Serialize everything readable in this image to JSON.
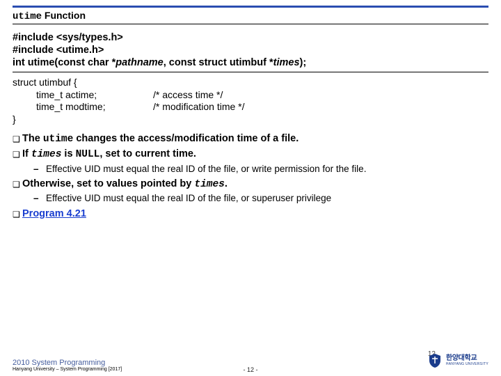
{
  "title": {
    "mono": "utime",
    "rest": " Function"
  },
  "signature": {
    "line1": "#include <sys/types.h>",
    "line2": "#include <utime.h>",
    "line3_a": "int utime(const char *",
    "line3_b": "pathname",
    "line3_c": ", const struct utimbuf *",
    "line3_d": "times",
    "line3_e": ");"
  },
  "struct": {
    "open": "struct utimbuf {",
    "r1_decl": "time_t  actime;",
    "r1_comment": "/* access time */",
    "r2_decl": "time_t  modtime;",
    "r2_comment": "/* modification time */",
    "close": "}"
  },
  "bullets": {
    "b1_a": "The ",
    "b1_mono": "utime",
    "b1_b": " changes the access/modification time of a file.",
    "b2_a": "If ",
    "b2_mono": "times",
    "b2_b": " is ",
    "b2_mono2": "NULL",
    "b2_c": ", set to current time.",
    "s1": "Effective UID must equal the real ID of the file, or write permission for the file.",
    "b3_a": "Otherwise, set to values pointed by ",
    "b3_mono": "times",
    "b3_b": ".",
    "s2": "Effective UID must equal the real ID of the file, or superuser privilege",
    "b4": "Program 4.21"
  },
  "footer": {
    "course": "2010 System Programming",
    "small": "Hanyang University – System Programming [2017]",
    "page_center": "- 12 -",
    "page_right": "12",
    "uni_kr": "한양대학교",
    "uni_en": "HANYANG UNIVERSITY"
  }
}
